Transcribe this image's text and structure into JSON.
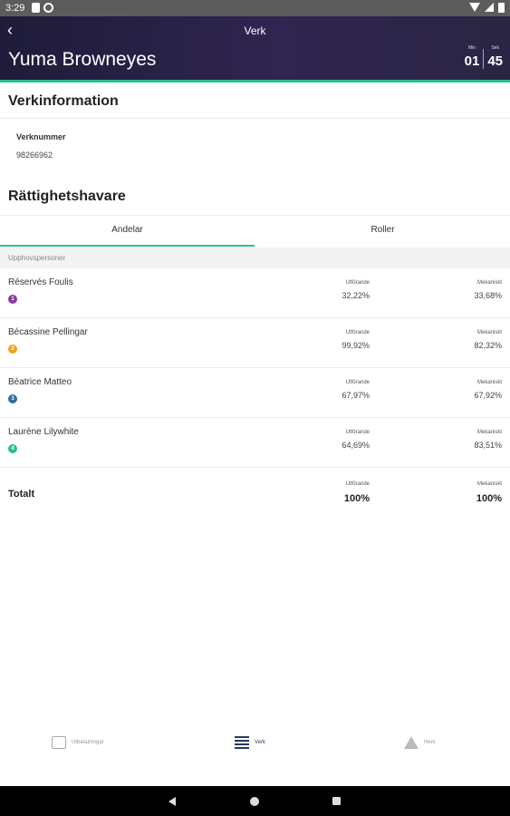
{
  "status_bar": {
    "time": "3:29"
  },
  "header": {
    "title": "Verk",
    "work_title": "Yuma Browneyes",
    "duration": {
      "min_label": "Min",
      "minutes": "01",
      "sec_label": "Sek",
      "seconds": "45"
    }
  },
  "info": {
    "title": "Verkinformation",
    "field_label": "Verknummer",
    "field_value": "98266962"
  },
  "rights": {
    "title": "Rättighetshavare",
    "tabs": [
      {
        "label": "Andelar",
        "active": true
      },
      {
        "label": "Roller",
        "active": false
      }
    ],
    "group_label": "Upphovspersoner",
    "col1_label": "Utförande",
    "col2_label": "Mekaniskt",
    "rows": [
      {
        "name": "Réservés Foulis",
        "index": "1",
        "color": "#8e3a9c",
        "col1": "32,22%",
        "col2": "33,68%"
      },
      {
        "name": "Bécassine Pellingar",
        "index": "2",
        "color": "#f0a323",
        "col1": "99,92%",
        "col2": "82,32%"
      },
      {
        "name": "Béatrice Matteo",
        "index": "3",
        "color": "#2b6f9e",
        "col1": "67,97%",
        "col2": "67,92%"
      },
      {
        "name": "Laurène Lilywhite",
        "index": "4",
        "color": "#27c08f",
        "col1": "64,69%",
        "col2": "83,51%"
      }
    ],
    "total": {
      "label": "Totalt",
      "col1": "100%",
      "col2": "100%"
    }
  },
  "bottom_nav": [
    {
      "label": "Utbetalningar",
      "icon": "payments-icon",
      "active": false
    },
    {
      "label": "Verk",
      "icon": "works-list-icon",
      "active": true
    },
    {
      "label": "Hem",
      "icon": "home-icon",
      "active": false
    }
  ],
  "colors": {
    "accent": "#27c08f",
    "header_bg": "#2a2544"
  }
}
